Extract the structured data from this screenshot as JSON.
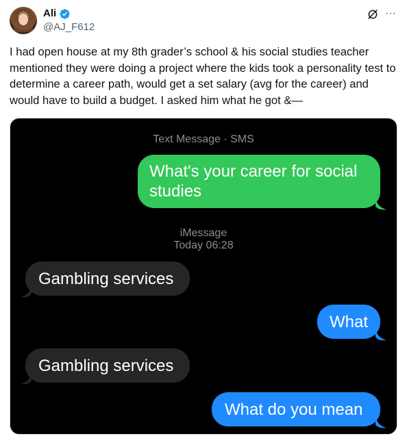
{
  "author": {
    "name": "Ali",
    "handle": "@AJ_F612",
    "verified": true,
    "verified_color": "#1d9bf0"
  },
  "header_icons": {
    "grok": "grok-icon",
    "more": "more-icon",
    "more_glyph": "···"
  },
  "tweet": {
    "text": "I had open house at my 8th grader’s school & his social studies teacher mentioned they were doing a project where the kids took a personality test to determine a career path, would get a set salary (avg for the career) and would have to build a budget. I asked him what he got &—"
  },
  "screenshot": {
    "sms_header": "Text Message · SMS",
    "imessage_header": "iMessage",
    "timestamp": "Today 06:28",
    "colors": {
      "sms_bubble": "#34c759",
      "imessage_bubble": "#1f8bff",
      "received_bubble": "#262628",
      "background": "#000000",
      "meta_text": "#8e8e93"
    },
    "messages": [
      {
        "direction": "sent",
        "service": "sms",
        "text": "What's your career for social studies"
      },
      {
        "direction": "received",
        "text": "Gambling services"
      },
      {
        "direction": "sent",
        "service": "imessage",
        "text": "What"
      },
      {
        "direction": "received",
        "text": "Gambling services"
      },
      {
        "direction": "sent",
        "service": "imessage",
        "text": "What do you mean"
      }
    ]
  }
}
